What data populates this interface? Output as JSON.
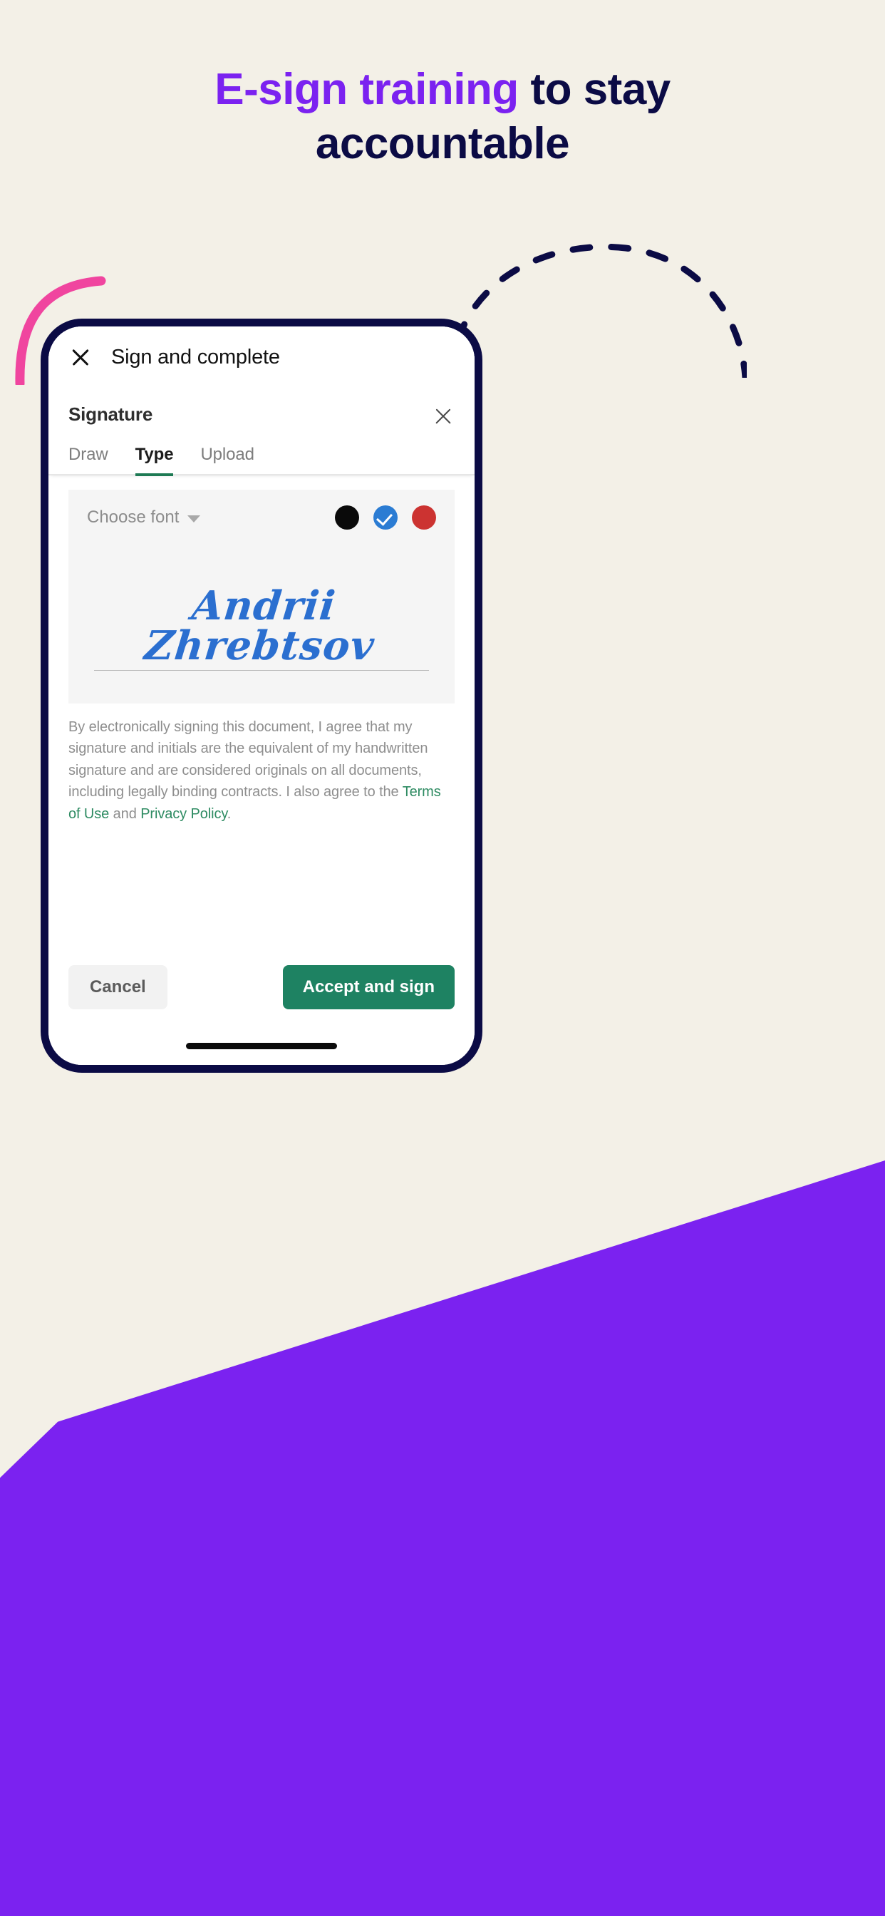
{
  "page": {
    "background_color": "#F3F0E7",
    "accent_purple": "#7B22F0",
    "navy": "#0B0B45",
    "pink": "#F0459F"
  },
  "headline": {
    "accent_text": "E-sign training",
    "rest_text": " to stay",
    "line2": "accountable"
  },
  "decorations": {
    "dashed_arc_name": "dashed-arc-decoration",
    "pink_arc_name": "pink-arc-decoration"
  },
  "app": {
    "topbar": {
      "close_icon": "close-icon",
      "title": "Sign and complete"
    },
    "sheet": {
      "title": "Signature",
      "close_icon": "close-icon",
      "tabs": [
        {
          "label": "Draw",
          "active": false
        },
        {
          "label": "Type",
          "active": true
        },
        {
          "label": "Upload",
          "active": false
        }
      ],
      "pad": {
        "font_selector_label": "Choose font",
        "caret_icon": "chevron-down-icon",
        "colors": [
          {
            "name": "black",
            "hex": "#0A0A0A",
            "selected": false
          },
          {
            "name": "blue",
            "hex": "#2B7CD3",
            "selected": true
          },
          {
            "name": "red",
            "hex": "#CC3331",
            "selected": false
          }
        ],
        "signature_text": "Andrii Zhrebtsov",
        "signature_color": "#2B6FD0"
      },
      "disclaimer": {
        "part1": "By electronically signing this document, I agree that my signature and initials are the equivalent of my handwritten signature and are considered originals on all documents, including legally binding contracts. I also agree to the ",
        "link1": "Terms of Use",
        "mid": " and ",
        "link2": "Privacy Policy",
        "end": "."
      },
      "footer": {
        "cancel_label": "Cancel",
        "accept_label": "Accept and sign",
        "accept_color": "#1E8262"
      }
    },
    "home_indicator": "home-indicator"
  }
}
